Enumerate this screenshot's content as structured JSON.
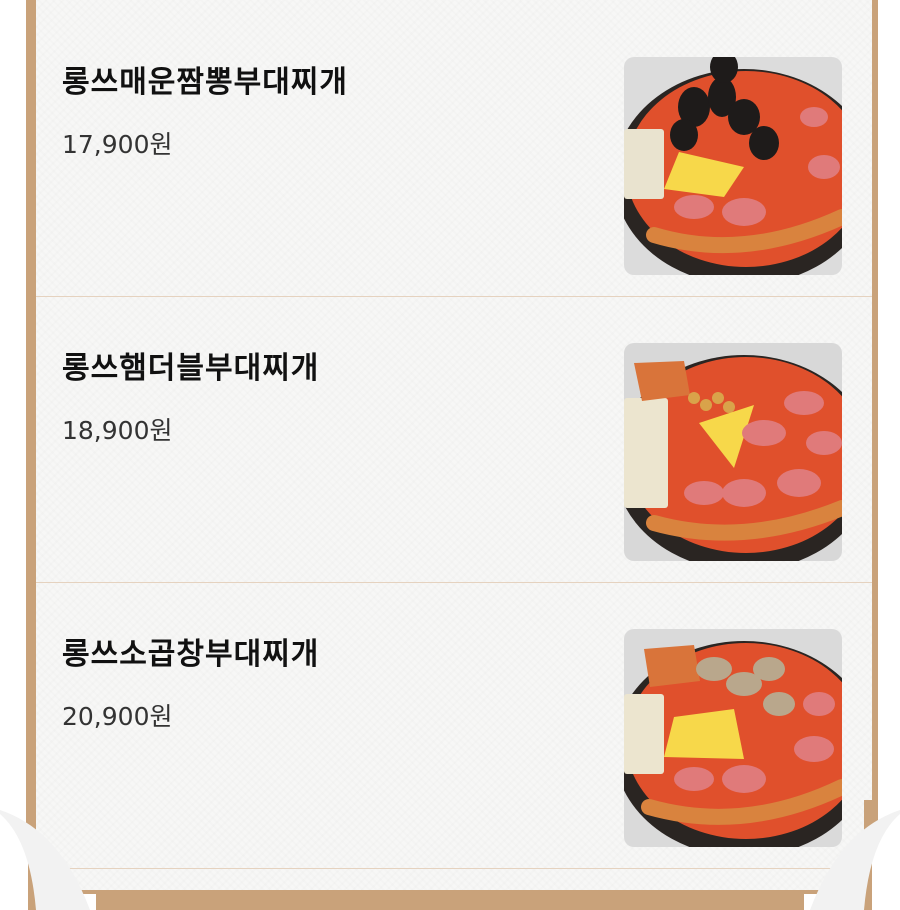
{
  "menu": {
    "items": [
      {
        "name": "롱쓰매운짬뽕부대찌개",
        "price": "17,900원",
        "image": "spicy-jjamppong-budae-jjigae-photo"
      },
      {
        "name": "롱쓰햄더블부대찌개",
        "price": "18,900원",
        "image": "ham-double-budae-jjigae-photo"
      },
      {
        "name": "롱쓰소곱창부대찌개",
        "price": "20,900원",
        "image": "beef-gopchang-budae-jjigae-photo"
      }
    ]
  },
  "colors": {
    "frame": "#c9a27a",
    "paper": "#f7f7f6",
    "divider": "#e5d2bf",
    "stew": "#e0502c",
    "pot": "#2a2522"
  }
}
